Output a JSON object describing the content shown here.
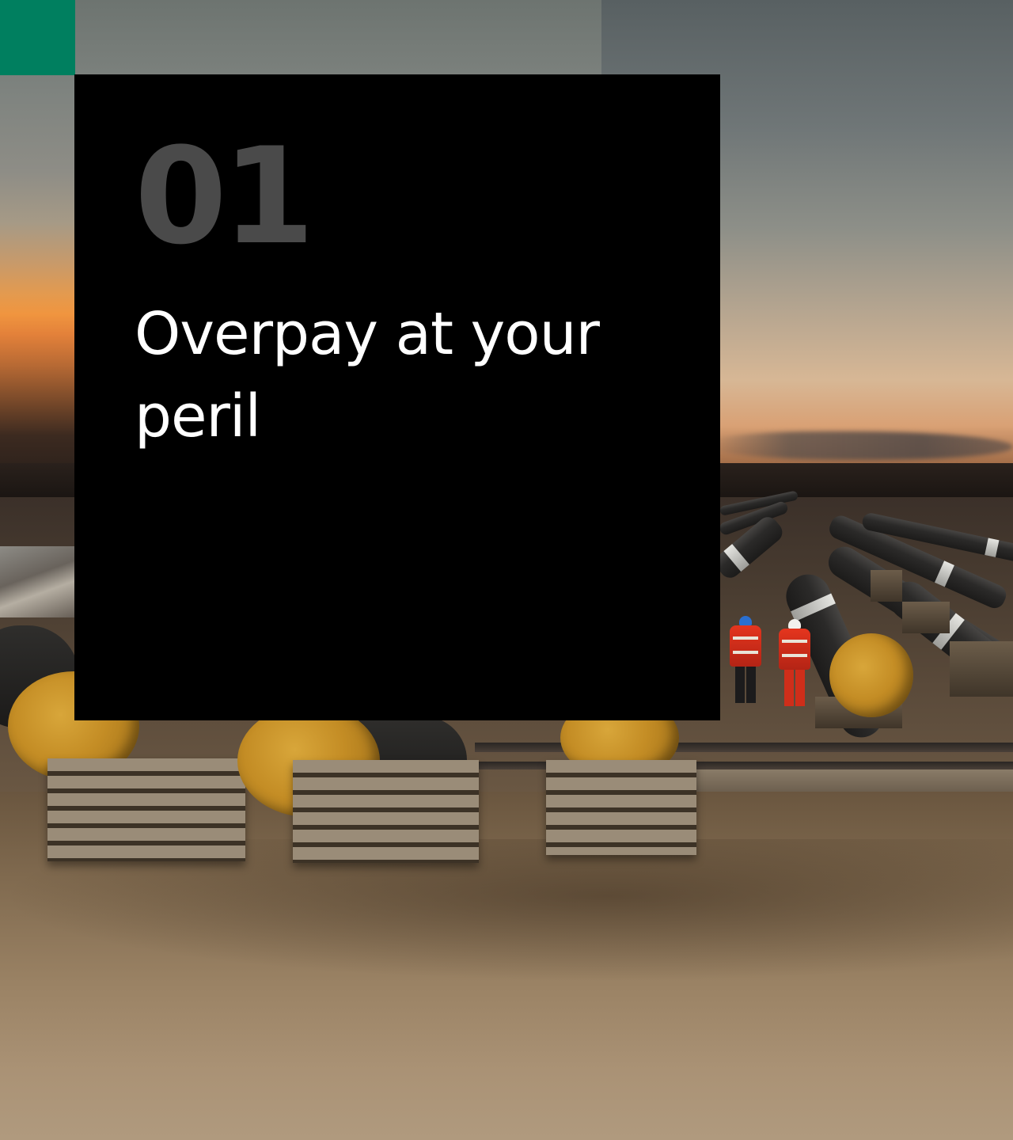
{
  "section": {
    "number": "01",
    "title": "Overpay at your peril"
  },
  "colors": {
    "accent": "#007f5f",
    "panel_background": "#000000",
    "number_text": "#4a4a4a",
    "title_text": "#ffffff"
  }
}
